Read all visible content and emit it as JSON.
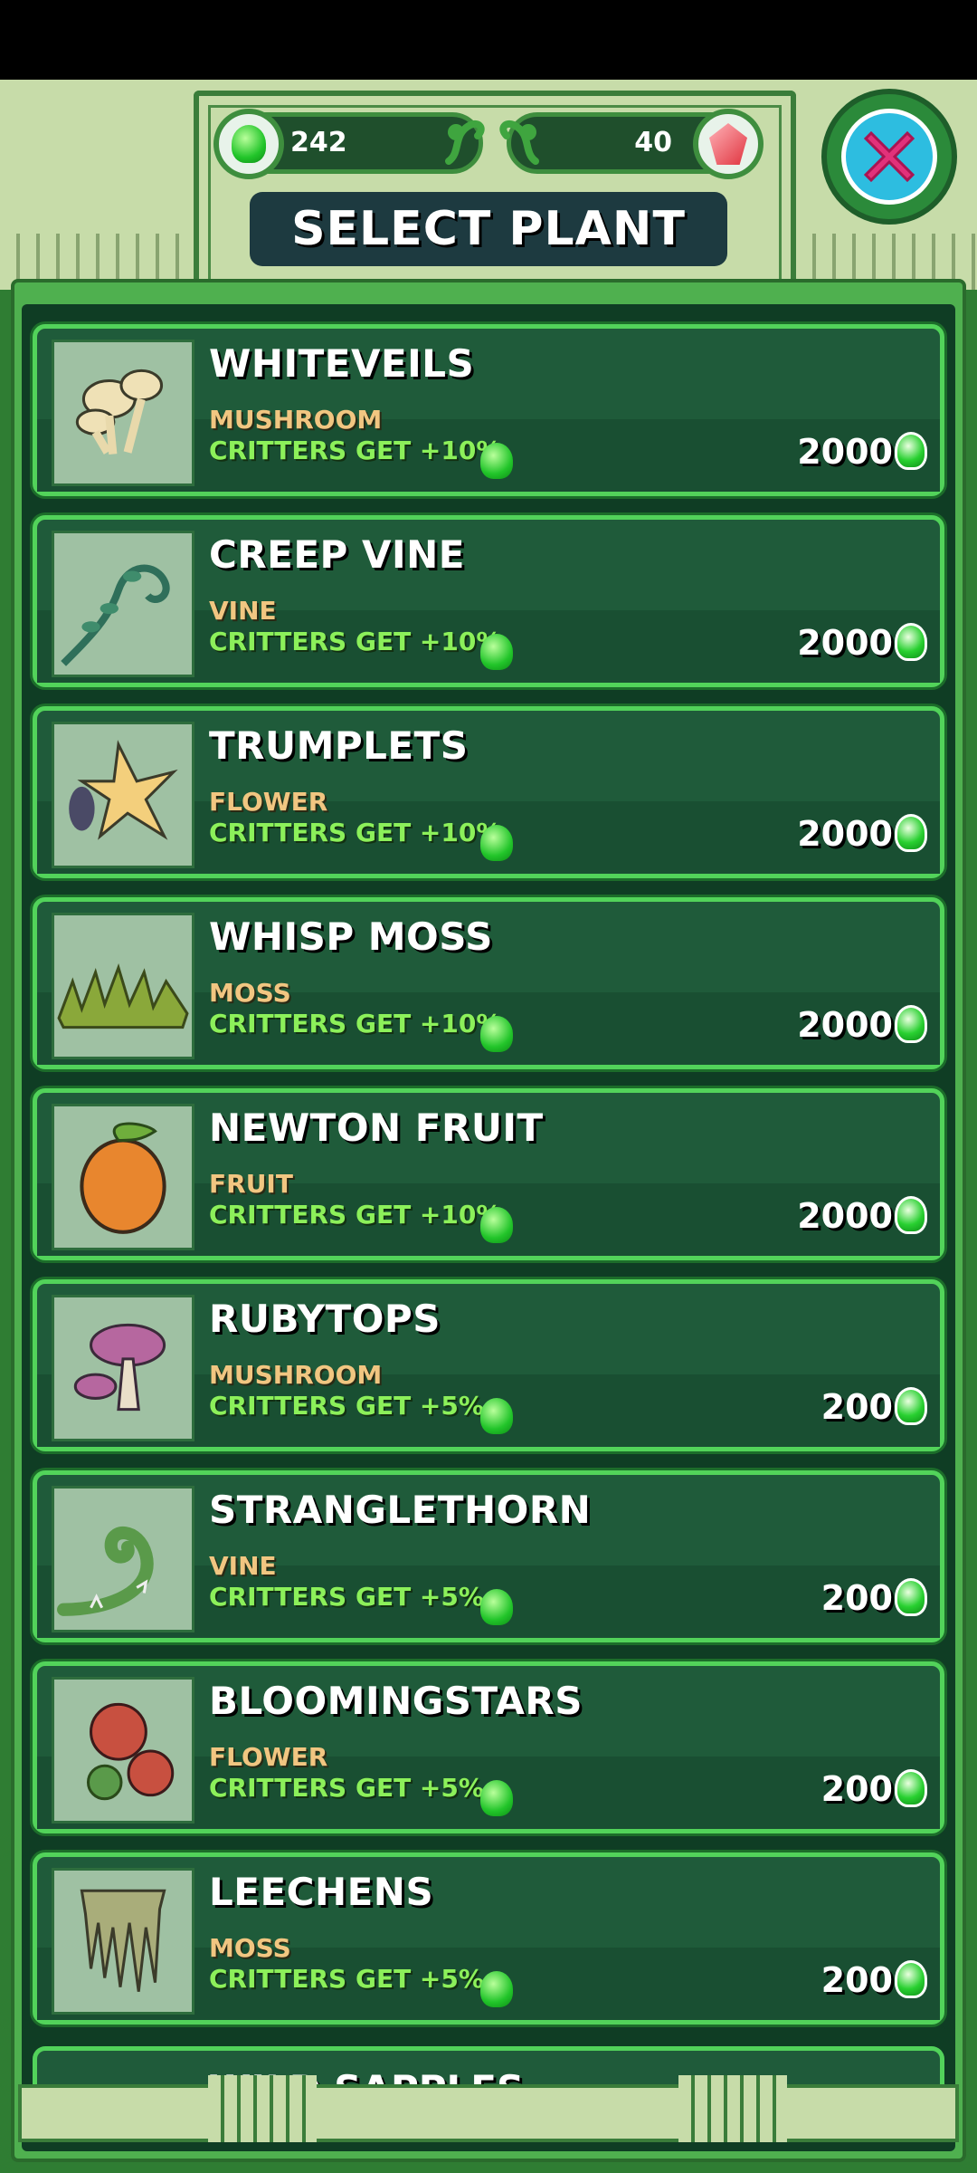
{
  "header": {
    "title": "SELECT PLANT",
    "gems": "242",
    "crystals": "40"
  },
  "icons": {
    "gem": "green-gem-icon",
    "crystal": "red-crystal-icon",
    "close": "close-x-icon"
  },
  "colors": {
    "card_bg": "#1f5b3a",
    "card_border": "#52d35a",
    "type_text": "#f1c681",
    "bonus_text": "#8cf05a",
    "title_box": "#1d3a40"
  },
  "plants": [
    {
      "name": "WHITEVEILS",
      "type": "MUSHROOM",
      "bonus": "CRITTERS GET +10%",
      "price": "2000"
    },
    {
      "name": "CREEP VINE",
      "type": "VINE",
      "bonus": "CRITTERS GET +10%",
      "price": "2000"
    },
    {
      "name": "TRUMPLETS",
      "type": "FLOWER",
      "bonus": "CRITTERS GET +10%",
      "price": "2000"
    },
    {
      "name": "WHISP MOSS",
      "type": "MOSS",
      "bonus": "CRITTERS GET +10%",
      "price": "2000"
    },
    {
      "name": "NEWTON FRUIT",
      "type": "FRUIT",
      "bonus": "CRITTERS GET +10%",
      "price": "2000"
    },
    {
      "name": "RUBYTOPS",
      "type": "MUSHROOM",
      "bonus": "CRITTERS GET +5%",
      "price": "200"
    },
    {
      "name": "STRANGLETHORN",
      "type": "VINE",
      "bonus": "CRITTERS GET +5%",
      "price": "200"
    },
    {
      "name": "BLOOMINGSTARS",
      "type": "FLOWER",
      "bonus": "CRITTERS GET +5%",
      "price": "200"
    },
    {
      "name": "LEECHENS",
      "type": "MOSS",
      "bonus": "CRITTERS GET +5%",
      "price": "200"
    }
  ],
  "peek_item": {
    "name": "WILD SAPPLES"
  }
}
